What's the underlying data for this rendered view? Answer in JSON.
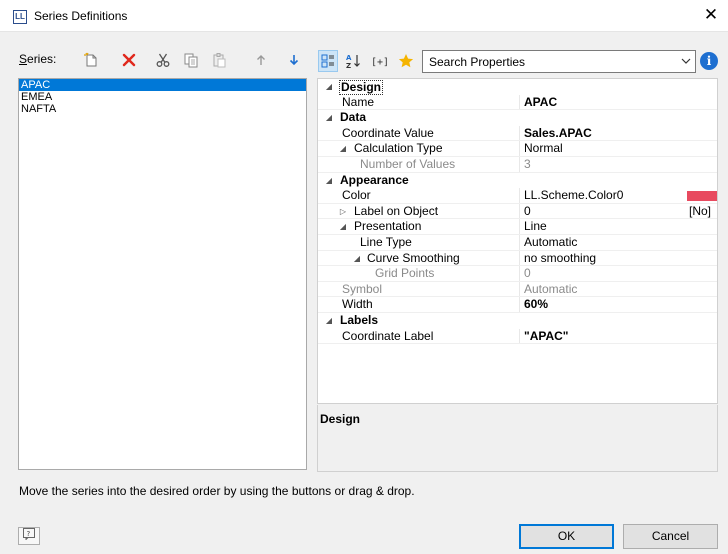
{
  "window": {
    "title": "Series Definitions",
    "icon_text": "LL",
    "close": "✕"
  },
  "series_panel": {
    "label_prefix": "S",
    "label_rest": "eries:",
    "items": [
      "APAC",
      "EMEA",
      "NAFTA"
    ],
    "selected_index": 0
  },
  "search": {
    "placeholder": "Search Properties"
  },
  "info_label": "i",
  "properties": {
    "design_cat": "Design",
    "name_label": "Name",
    "name_value": "APAC",
    "data_cat": "Data",
    "coord_value_label": "Coordinate Value",
    "coord_value": "Sales.APAC",
    "calc_type_label": "Calculation Type",
    "calc_type_value": "Normal",
    "num_values_label": "Number of Values",
    "num_values_value": "3",
    "appearance_cat": "Appearance",
    "color_label": "Color",
    "color_value": "LL.Scheme.Color0",
    "color_swatch": "#e84a5f",
    "label_obj_label": "Label on Object",
    "label_obj_value": "0",
    "label_obj_tag": "[No]",
    "presentation_label": "Presentation",
    "presentation_value": "Line",
    "line_type_label": "Line Type",
    "line_type_value": "Automatic",
    "curve_label": "Curve Smoothing",
    "curve_value": "no smoothing",
    "grid_points_label": "Grid Points",
    "grid_points_value": "0",
    "symbol_label": "Symbol",
    "symbol_value": "Automatic",
    "width_label": "Width",
    "width_value": "60%",
    "labels_cat": "Labels",
    "coord_label_label": "Coordinate Label",
    "coord_label_value": "\"APAC\""
  },
  "description": {
    "title": "Design"
  },
  "hint": "Move the series into the desired order by using the buttons or drag & drop.",
  "buttons": {
    "ok": "OK",
    "cancel": "Cancel",
    "help": "?"
  },
  "colors": {
    "selection": "#0078d7",
    "accent": "#1e6fd0",
    "delete": "#e0281c"
  }
}
